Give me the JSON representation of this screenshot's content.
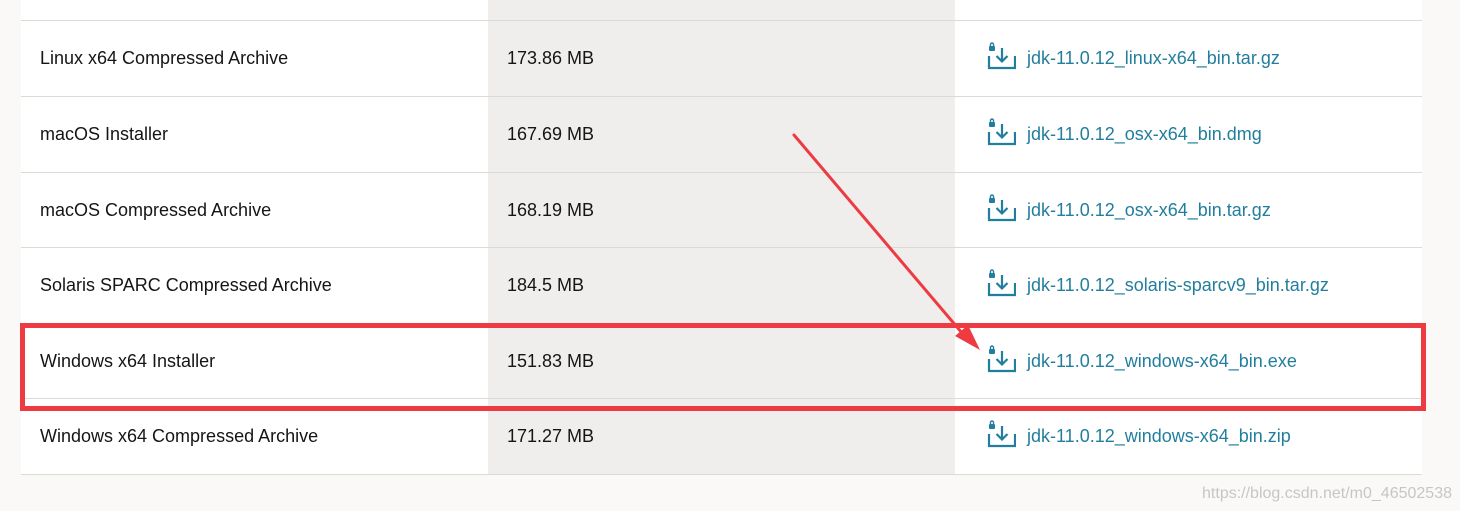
{
  "downloads": [
    {
      "product": "Linux x64 Compressed Archive",
      "size": "173.86 MB",
      "file": "jdk-11.0.12_linux-x64_bin.tar.gz"
    },
    {
      "product": "macOS Installer",
      "size": "167.69 MB",
      "file": "jdk-11.0.12_osx-x64_bin.dmg"
    },
    {
      "product": "macOS Compressed Archive",
      "size": "168.19 MB",
      "file": "jdk-11.0.12_osx-x64_bin.tar.gz"
    },
    {
      "product": "Solaris SPARC Compressed Archive",
      "size": "184.5 MB",
      "file": "jdk-11.0.12_solaris-sparcv9_bin.tar.gz"
    },
    {
      "product": "Windows x64 Installer",
      "size": "151.83 MB",
      "file": "jdk-11.0.12_windows-x64_bin.exe"
    },
    {
      "product": "Windows x64 Compressed Archive",
      "size": "171.27 MB",
      "file": "jdk-11.0.12_windows-x64_bin.zip"
    }
  ],
  "icons": {
    "download": "download-lock-icon"
  },
  "colors": {
    "link": "#227e9e",
    "highlight": "#ee3b41",
    "column_shade": "#efeeec"
  },
  "watermark": "https://blog.csdn.net/m0_46502538"
}
